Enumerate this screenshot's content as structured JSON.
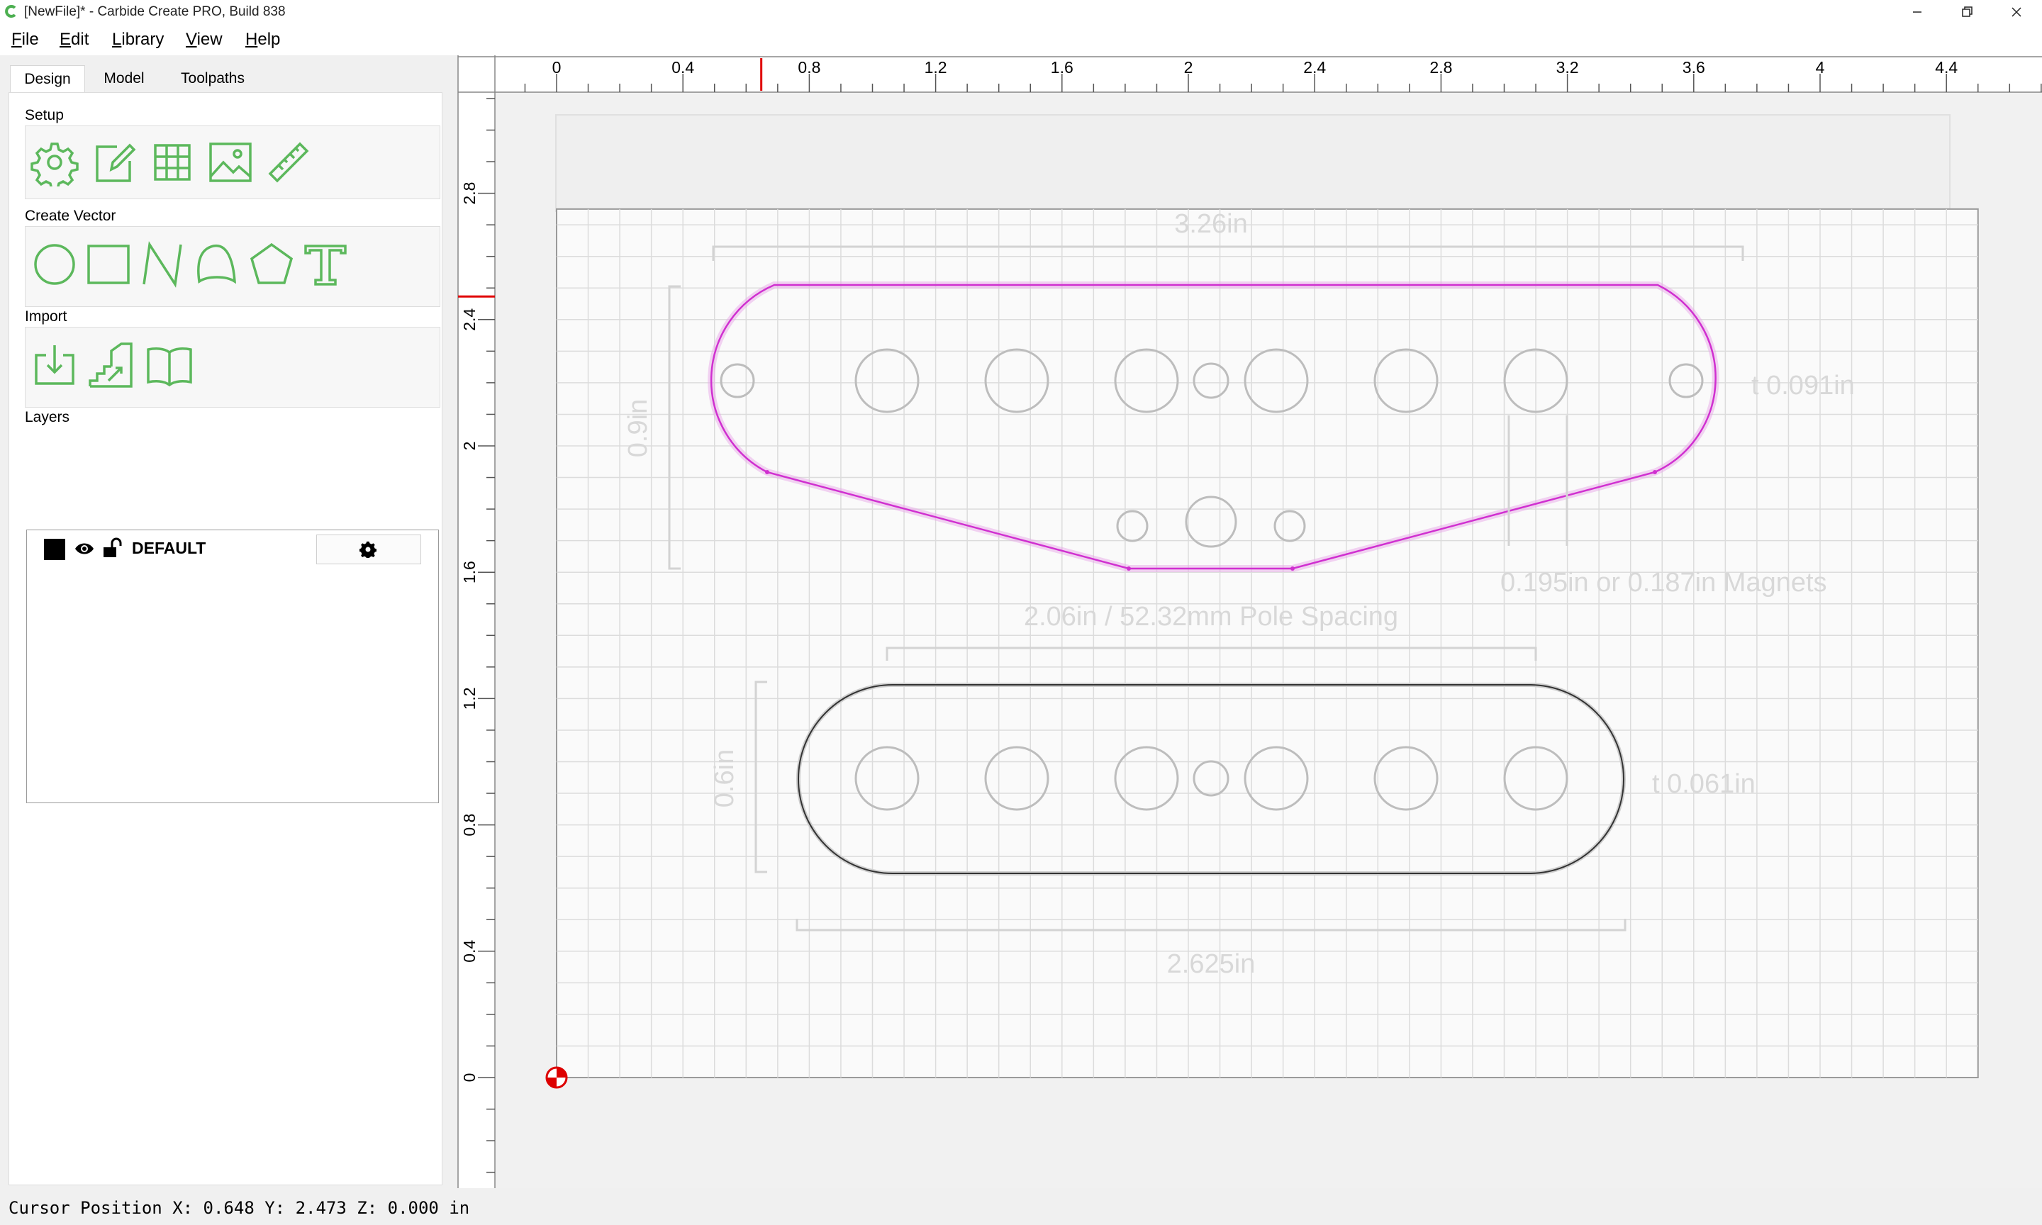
{
  "window": {
    "title": "[NewFile]* - Carbide Create PRO, Build 838",
    "controls": [
      "minimize",
      "restore",
      "close"
    ]
  },
  "menu": [
    {
      "label": "File",
      "mnemonic": "F"
    },
    {
      "label": "Edit",
      "mnemonic": "E"
    },
    {
      "label": "Library",
      "mnemonic": "L"
    },
    {
      "label": "View",
      "mnemonic": "V"
    },
    {
      "label": "Help",
      "mnemonic": "H"
    }
  ],
  "tabs": [
    {
      "label": "Design",
      "active": true
    },
    {
      "label": "Model",
      "active": false
    },
    {
      "label": "Toolpaths",
      "active": false
    }
  ],
  "setup": {
    "title": "Setup",
    "icons": [
      "gear-icon",
      "edit-icon",
      "grid-icon",
      "image-icon",
      "ruler-icon"
    ]
  },
  "create_vector": {
    "title": "Create Vector",
    "icons": [
      "circle-icon",
      "rectangle-icon",
      "polyline-icon",
      "curve-icon",
      "polygon-icon",
      "text-icon"
    ]
  },
  "import": {
    "title": "Import",
    "icons": [
      "import-icon",
      "import-steps-icon",
      "library-book-icon"
    ]
  },
  "layers": {
    "title": "Layers",
    "items": [
      {
        "name": "DEFAULT",
        "color": "#000000",
        "visible": true,
        "locked": false
      }
    ]
  },
  "status": {
    "cursor_position": "Cursor Position X: 0.648 Y: 2.473 Z: 0.000 in"
  },
  "colors": {
    "accent_green": "#5cb85c",
    "selection_magenta": "#e040e0",
    "ruler_marker": "#e00000"
  },
  "rulers": {
    "units": "in",
    "x_labels": [
      "0",
      "0.4",
      "0.8",
      "1.2",
      "1.6",
      "2",
      "2.4",
      "2.8",
      "3.2",
      "3.6",
      "4",
      "4.4"
    ],
    "y_labels": [
      "0",
      "0.4",
      "0.8",
      "1.2",
      "1.6",
      "2",
      "2.4",
      "2.8"
    ],
    "cursor_x": 0.648,
    "cursor_y": 2.473
  },
  "drawing": {
    "stock": {
      "width": 4.5,
      "height": 2.75
    },
    "annotations": {
      "top_width": "3.26in",
      "top_height": "0.9in",
      "top_thickness": "t 0.091in",
      "magnets": "0.195in or 0.187in Magnets",
      "pole_spacing": "2.06in / 52.32mm Pole Spacing",
      "bottom_height": "0.6in",
      "bottom_thickness": "t 0.061in",
      "bottom_width": "2.625in"
    }
  }
}
